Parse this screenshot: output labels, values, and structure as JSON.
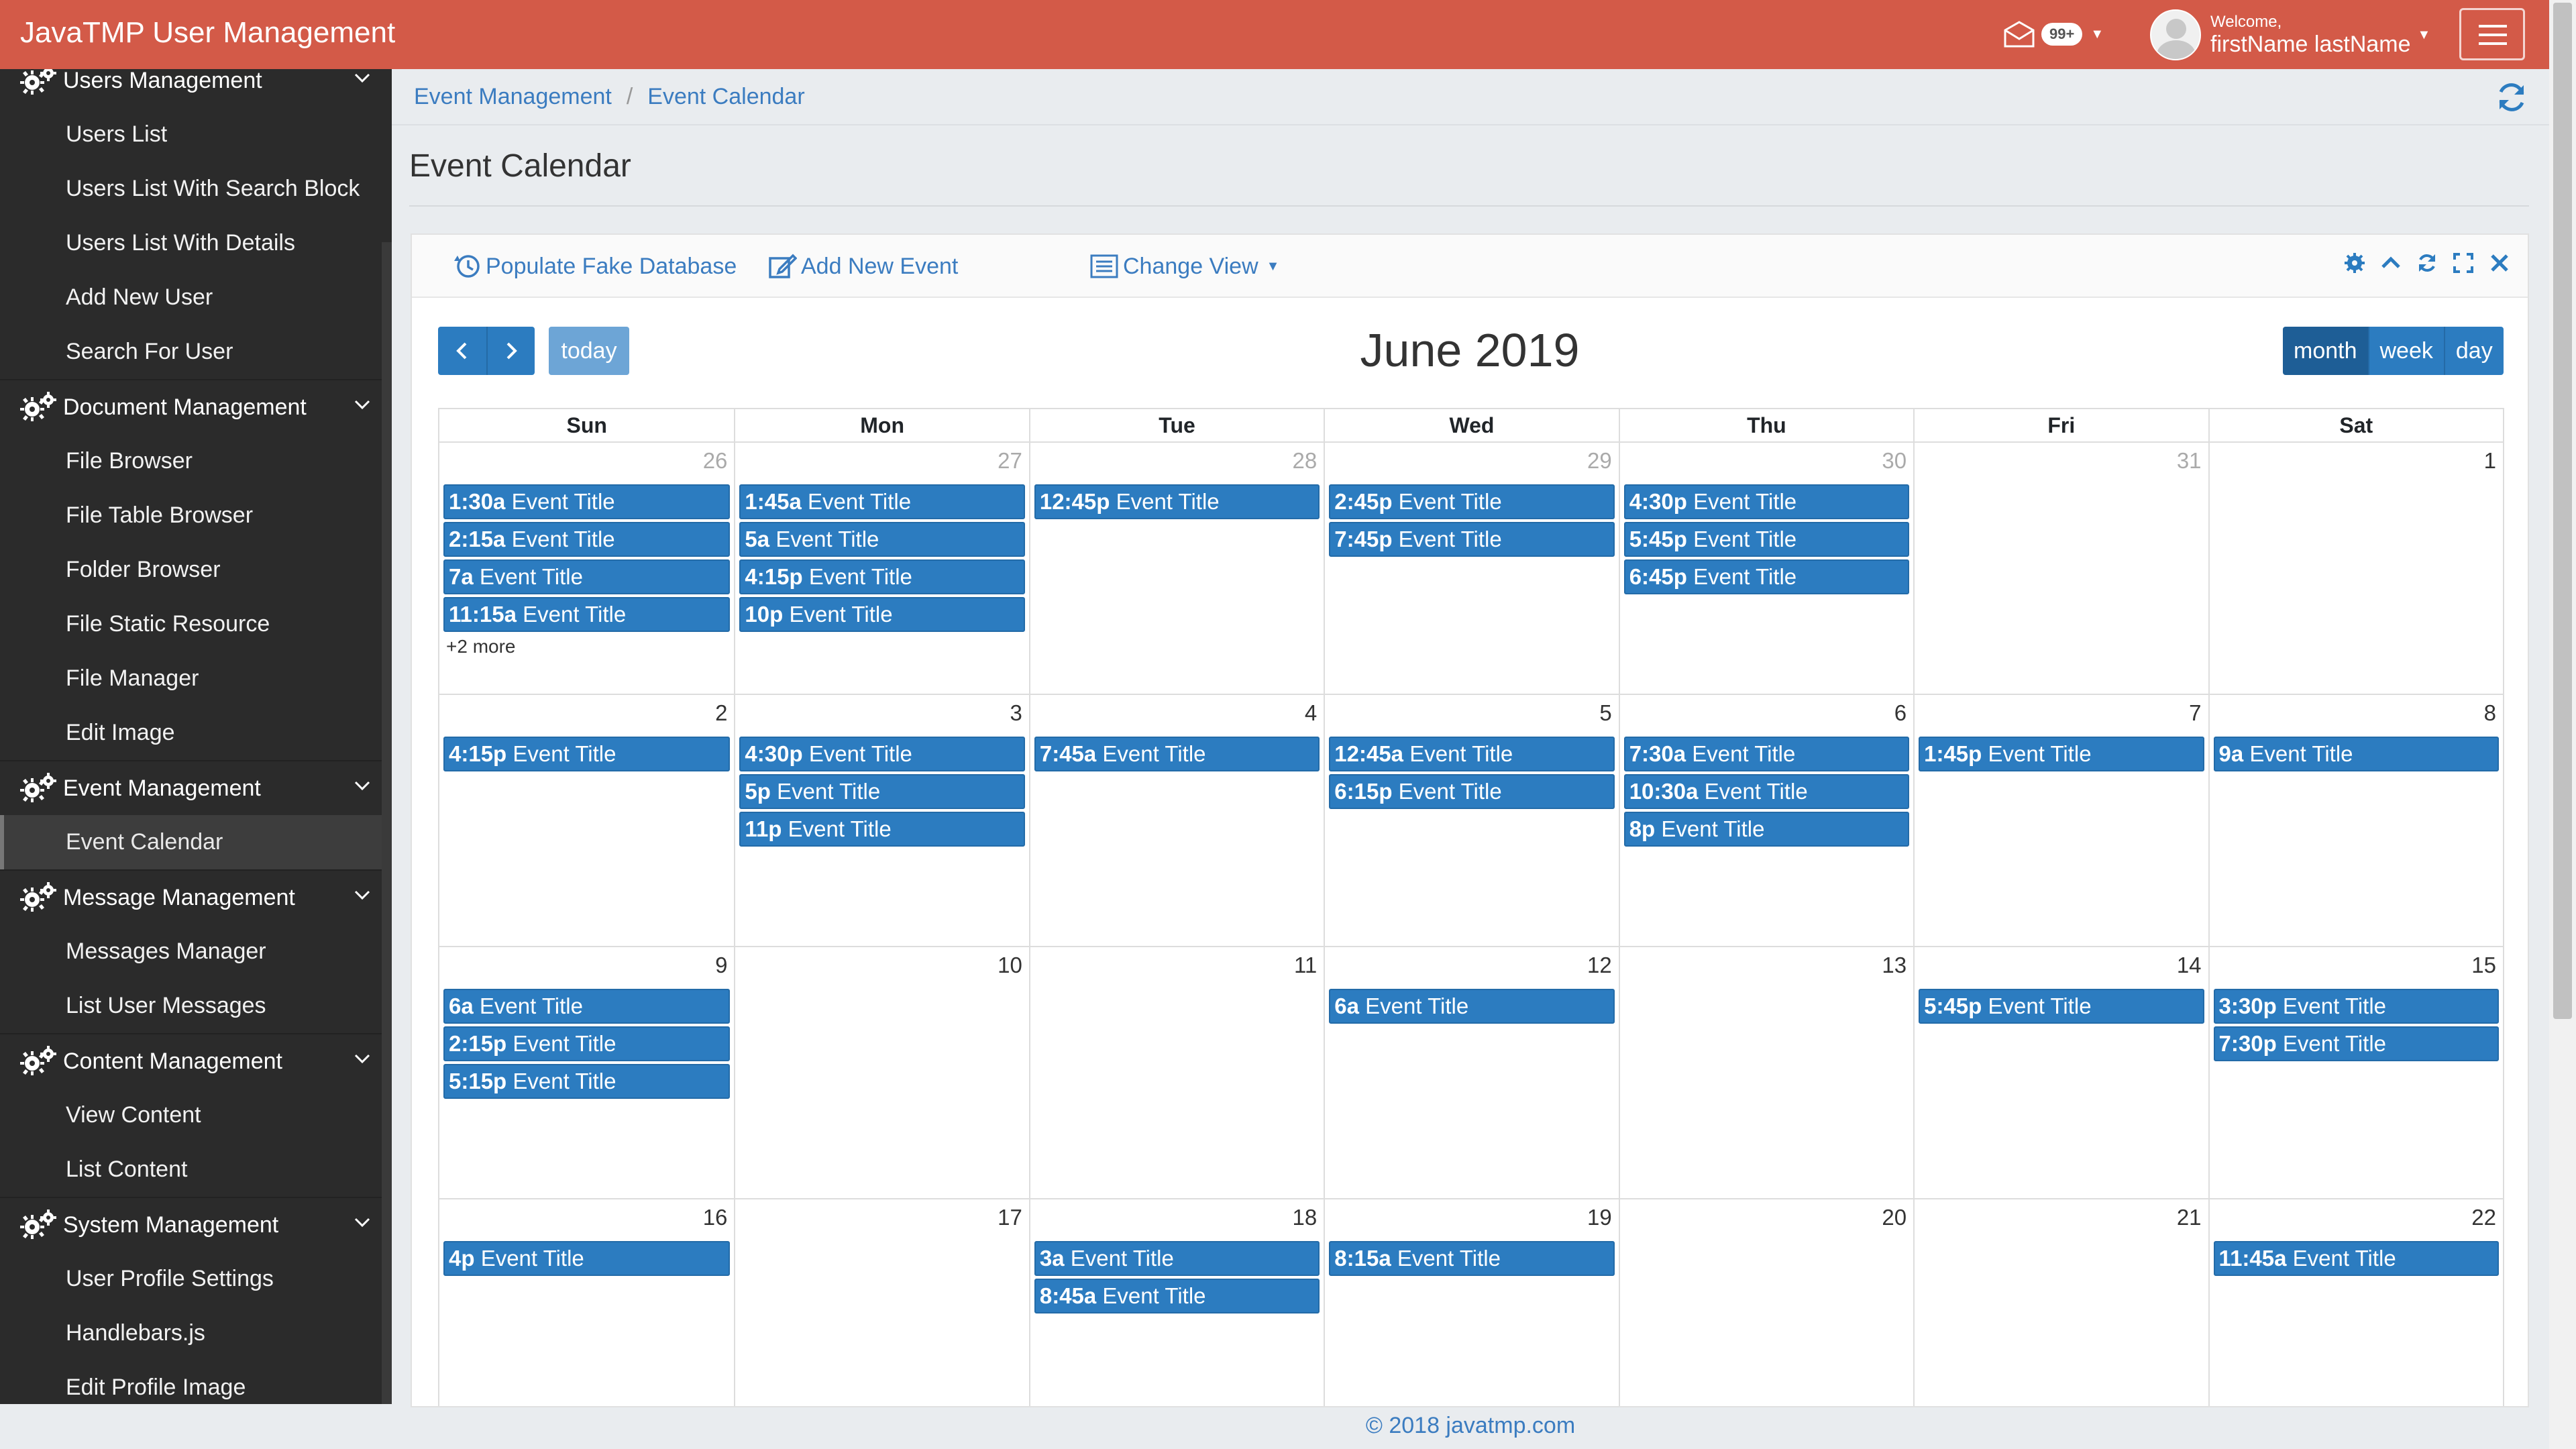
{
  "app": {
    "brand": "JavaTMP User Management"
  },
  "header": {
    "mail_badge": "99+",
    "welcome": "Welcome,",
    "user_name": "firstName lastName"
  },
  "sidebar": {
    "sections": [
      {
        "title": "Users Management",
        "items": [
          "Users List",
          "Users List With Search Block",
          "Users List With Details",
          "Add New User",
          "Search For User"
        ]
      },
      {
        "title": "Document Management",
        "items": [
          "File Browser",
          "File Table Browser",
          "Folder Browser",
          "File Static Resource",
          "File Manager",
          "Edit Image"
        ]
      },
      {
        "title": "Event Management",
        "items": [
          "Event Calendar"
        ]
      },
      {
        "title": "Message Management",
        "items": [
          "Messages Manager",
          "List User Messages"
        ]
      },
      {
        "title": "Content Management",
        "items": [
          "View Content",
          "List Content"
        ]
      },
      {
        "title": "System Management",
        "items": [
          "User Profile Settings",
          "Handlebars.js",
          "Edit Profile Image"
        ]
      }
    ],
    "active_item": "Event Calendar"
  },
  "breadcrumb": [
    "Event Management",
    "Event Calendar"
  ],
  "page_title": "Event Calendar",
  "panel": {
    "populate_label": "Populate Fake Database",
    "add_label": "Add New Event",
    "view_label": "Change View"
  },
  "calendar": {
    "title": "June 2019",
    "today_label": "today",
    "views": [
      "month",
      "week",
      "day"
    ],
    "active_view": "month",
    "days_of_week": [
      "Sun",
      "Mon",
      "Tue",
      "Wed",
      "Thu",
      "Fri",
      "Sat"
    ],
    "weeks": [
      [
        {
          "day": "26",
          "other": true,
          "events": [
            "1:30a",
            "2:15a",
            "7a",
            "11:15a"
          ],
          "more": "+2 more"
        },
        {
          "day": "27",
          "other": true,
          "events": [
            "1:45a",
            "5a",
            "4:15p",
            "10p"
          ]
        },
        {
          "day": "28",
          "other": true,
          "events": [
            "12:45p"
          ]
        },
        {
          "day": "29",
          "other": true,
          "events": [
            "2:45p",
            "7:45p"
          ]
        },
        {
          "day": "30",
          "other": true,
          "events": [
            "4:30p",
            "5:45p",
            "6:45p"
          ]
        },
        {
          "day": "31",
          "other": true,
          "events": []
        },
        {
          "day": "1",
          "other": false,
          "events": []
        }
      ],
      [
        {
          "day": "2",
          "other": false,
          "events": [
            "4:15p"
          ]
        },
        {
          "day": "3",
          "other": false,
          "events": [
            "4:30p",
            "5p",
            "11p"
          ]
        },
        {
          "day": "4",
          "other": false,
          "events": [
            "7:45a"
          ]
        },
        {
          "day": "5",
          "other": false,
          "events": [
            "12:45a",
            "6:15p"
          ]
        },
        {
          "day": "6",
          "other": false,
          "events": [
            "7:30a",
            "10:30a",
            "8p"
          ]
        },
        {
          "day": "7",
          "other": false,
          "events": [
            "1:45p"
          ]
        },
        {
          "day": "8",
          "other": false,
          "events": [
            "9a"
          ]
        }
      ],
      [
        {
          "day": "9",
          "other": false,
          "events": [
            "6a",
            "2:15p",
            "5:15p"
          ]
        },
        {
          "day": "10",
          "other": false,
          "events": []
        },
        {
          "day": "11",
          "other": false,
          "events": []
        },
        {
          "day": "12",
          "other": false,
          "events": [
            "6a"
          ]
        },
        {
          "day": "13",
          "other": false,
          "events": []
        },
        {
          "day": "14",
          "other": false,
          "events": [
            "5:45p"
          ]
        },
        {
          "day": "15",
          "other": false,
          "events": [
            "3:30p",
            "7:30p"
          ]
        }
      ],
      [
        {
          "day": "16",
          "other": false,
          "events": [
            "4p"
          ]
        },
        {
          "day": "17",
          "other": false,
          "events": []
        },
        {
          "day": "18",
          "other": false,
          "events": [
            "3a",
            "8:45a"
          ]
        },
        {
          "day": "19",
          "other": false,
          "events": [
            "8:15a"
          ]
        },
        {
          "day": "20",
          "other": false,
          "events": []
        },
        {
          "day": "21",
          "other": false,
          "events": []
        },
        {
          "day": "22",
          "other": false,
          "events": [
            "11:45a"
          ]
        }
      ]
    ],
    "event_title": "Event Title"
  },
  "footer": "© 2018 javatmp.com",
  "colors": {
    "navbar": "#d35a48",
    "accent": "#2c7cc0",
    "sidebar": "#2b2b2b"
  }
}
